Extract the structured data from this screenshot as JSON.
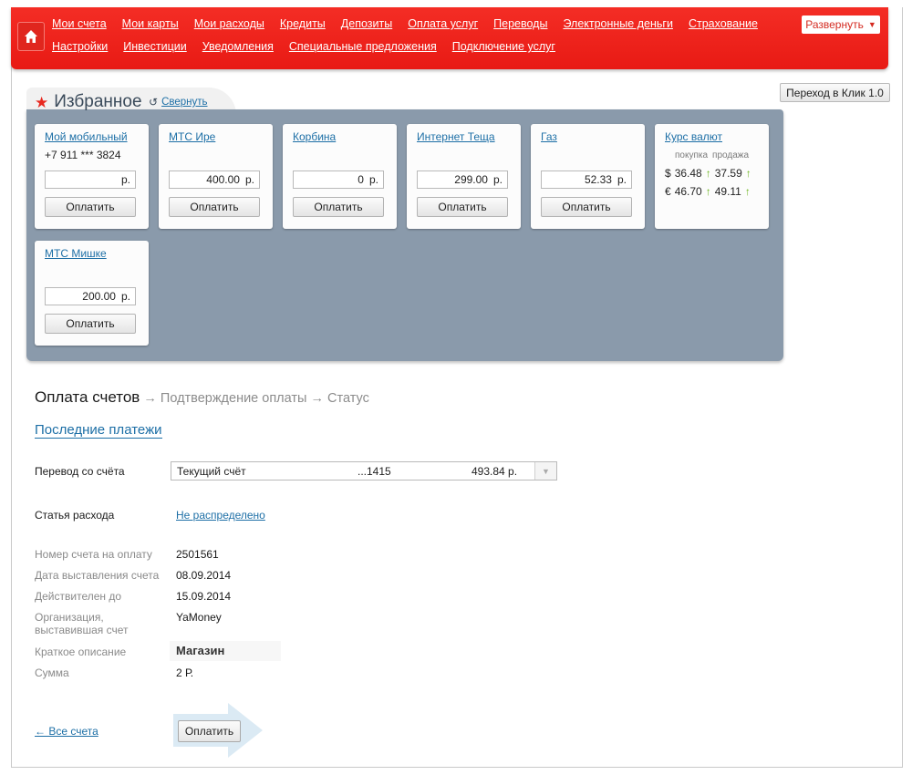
{
  "nav": {
    "row1": [
      "Мои счета",
      "Мои карты",
      "Мои расходы",
      "Кредиты",
      "Депозиты",
      "Оплата услуг",
      "Переводы",
      "Электронные деньги",
      "Страхование"
    ],
    "row2": [
      "Настройки",
      "Инвестиции",
      "Уведомления",
      "Специальные предложения",
      "Подключение услуг"
    ],
    "expand_label": "Развернуть"
  },
  "klik_button": "Переход в Клик 1.0",
  "favorites": {
    "title": "Избранное",
    "collapse_label": "Свернуть",
    "pay_label": "Оплатить",
    "currency": "р.",
    "cards": [
      {
        "title": "Мой мобильный",
        "sub": "+7 911 *** 3824",
        "amount": ""
      },
      {
        "title": "МТС Ире",
        "sub": "",
        "amount": "400.00"
      },
      {
        "title": "Корбина",
        "sub": "",
        "amount": "0"
      },
      {
        "title": "Интернет Теща",
        "sub": "",
        "amount": "299.00"
      },
      {
        "title": "Газ",
        "sub": "",
        "amount": "52.33"
      },
      {
        "title": "МТС Мишке",
        "sub": "",
        "amount": "200.00"
      }
    ],
    "rates": {
      "title": "Курс валют",
      "buy_label": "покупка",
      "sell_label": "продажа",
      "usd": {
        "symbol": "$",
        "buy": "36.48",
        "sell": "37.59"
      },
      "eur": {
        "symbol": "€",
        "buy": "46.70",
        "sell": "49.11"
      },
      "arrow": "↑"
    }
  },
  "payment": {
    "steps_current": "Оплата счетов",
    "steps_rest": " → Подтверждение оплаты → Статус",
    "last_payments": "Последние платежи",
    "transfer_label": "Перевод со счёта",
    "account_name": "Текущий счёт",
    "account_number": "...1415",
    "account_balance": "493.84 р.",
    "expense_label": "Статья расхода",
    "expense_value": "Не распределено",
    "invoice_number_label": "Номер счета на оплату",
    "invoice_number": "2501561",
    "issue_date_label": "Дата выставления счета",
    "issue_date": "08.09.2014",
    "valid_until_label": "Действителен до",
    "valid_until": "15.09.2014",
    "org_label_1": "Организация,",
    "org_label_2": "выставившая счет",
    "org_value": "YaMoney",
    "desc_label": "Краткое описание",
    "desc_value": "Магазин",
    "sum_label": "Сумма",
    "sum_value": "2 Р.",
    "back_link": "← Все счета",
    "pay_button": "Оплатить"
  }
}
